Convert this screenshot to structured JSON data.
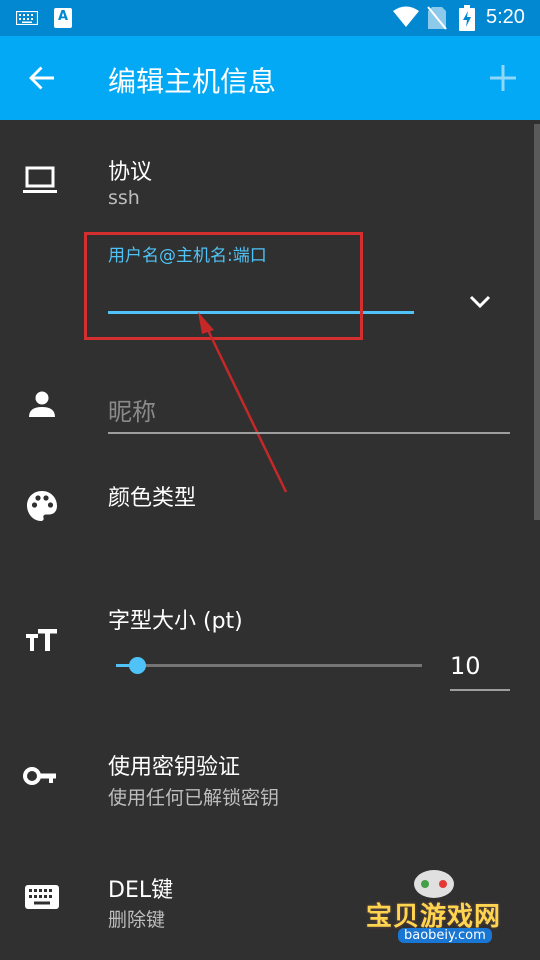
{
  "status_bar": {
    "keyboard_icon": "keyboard-icon",
    "app_icon_letter": "A",
    "time": "5:20"
  },
  "app_bar": {
    "title": "编辑主机信息",
    "back_icon": "arrow-back-icon",
    "add_icon": "add-icon"
  },
  "protocol": {
    "label": "协议",
    "value": "ssh",
    "icon": "laptop-icon"
  },
  "host_field": {
    "floating_label": "用户名@主机名:端口",
    "value": "",
    "dropdown_icon": "chevron-down-icon"
  },
  "nickname": {
    "placeholder": "昵称",
    "icon": "person-icon"
  },
  "color": {
    "label": "颜色类型",
    "icon": "palette-icon"
  },
  "font_size": {
    "label": "字型大小 (pt)",
    "value": "10",
    "slider_fraction": 0.07,
    "icon": "text-size-icon"
  },
  "use_key": {
    "label": "使用密钥验证",
    "sub": "使用任何已解锁密钥",
    "icon": "key-icon"
  },
  "del_key": {
    "label": "DEL键",
    "sub": "删除键",
    "icon": "keyboard-icon"
  },
  "watermark": {
    "text": "宝贝游戏网",
    "url": "baobeiy.com"
  },
  "colors": {
    "accent": "#4fc3f7",
    "app_bar": "#03a9f4",
    "status_bar": "#0288d1",
    "annotation": "#d32f2f"
  }
}
